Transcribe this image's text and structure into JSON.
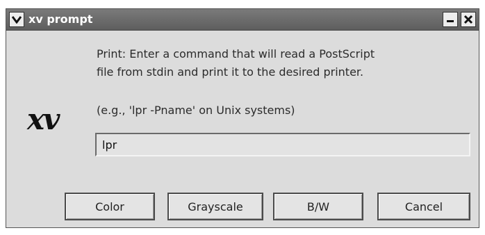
{
  "window": {
    "title": "xv prompt"
  },
  "logo": {
    "text": "xv"
  },
  "message": {
    "line1": "Print:  Enter a command that will read a PostScript",
    "line2": "file from stdin and print it to the desired printer.",
    "hint": "(e.g., 'lpr -Pname' on Unix systems)"
  },
  "command_input": {
    "value": "lpr"
  },
  "buttons": {
    "color": "Color",
    "grayscale": "Grayscale",
    "bw": "B/W",
    "cancel": "Cancel"
  },
  "icons": {
    "menu": "chevron-down-icon",
    "minimize": "minimize-icon",
    "close": "close-icon"
  }
}
